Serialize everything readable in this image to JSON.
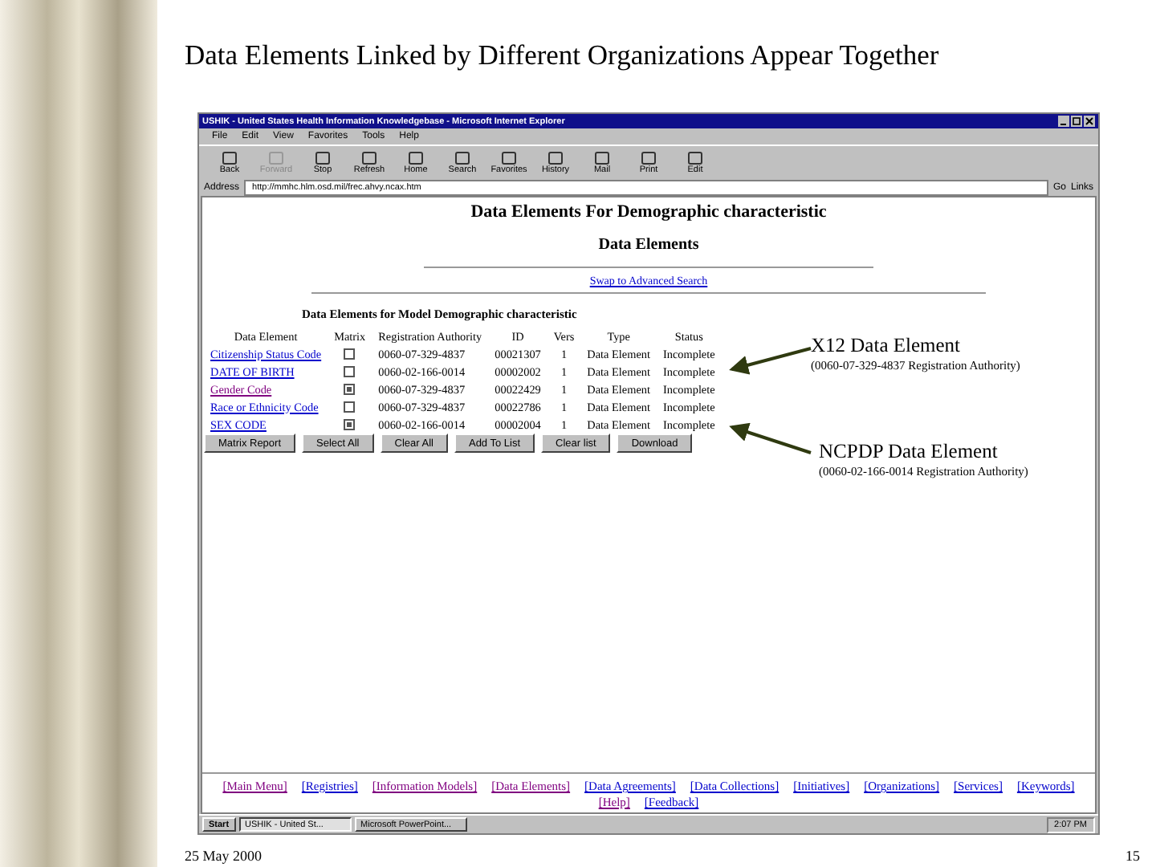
{
  "slide": {
    "title": "Data Elements Linked by Different Organizations Appear Together",
    "date": "25 May 2000",
    "page_number": "15"
  },
  "browser": {
    "title": "USHIK - United States Health Information Knowledgebase - Microsoft Internet Explorer",
    "menu": [
      "File",
      "Edit",
      "View",
      "Favorites",
      "Tools",
      "Help"
    ],
    "toolbar": [
      {
        "label": "Back",
        "disabled": false
      },
      {
        "label": "Forward",
        "disabled": true
      },
      {
        "label": "Stop",
        "disabled": false
      },
      {
        "label": "Refresh",
        "disabled": false
      },
      {
        "label": "Home",
        "disabled": false
      },
      {
        "label": "Search",
        "disabled": false
      },
      {
        "label": "Favorites",
        "disabled": false
      },
      {
        "label": "History",
        "disabled": false
      },
      {
        "label": "Mail",
        "disabled": false
      },
      {
        "label": "Print",
        "disabled": false
      },
      {
        "label": "Edit",
        "disabled": false
      }
    ],
    "address_label": "Address",
    "address": "http://mmhc.hlm.osd.mil/frec.ahvy.ncax.htm",
    "go": "Go",
    "links": "Links"
  },
  "page": {
    "heading": "Data Elements For Demographic characteristic",
    "subheading": "Data Elements",
    "swap_link": "Swap to Advanced Search",
    "table_title": "Data Elements for Model Demographic characteristic",
    "columns": [
      "Data Element",
      "Matrix",
      "Registration Authority",
      "ID",
      "Vers",
      "Type",
      "Status"
    ],
    "rows": [
      {
        "name": "Citizenship Status Code",
        "visited": false,
        "checked": false,
        "authority": "0060-07-329-4837",
        "id": "00021307",
        "vers": "1",
        "type": "Data Element",
        "status": "Incomplete"
      },
      {
        "name": "DATE OF BIRTH",
        "visited": false,
        "checked": false,
        "authority": "0060-02-166-0014",
        "id": "00002002",
        "vers": "1",
        "type": "Data Element",
        "status": "Incomplete"
      },
      {
        "name": "Gender Code",
        "visited": true,
        "checked": true,
        "authority": "0060-07-329-4837",
        "id": "00022429",
        "vers": "1",
        "type": "Data Element",
        "status": "Incomplete"
      },
      {
        "name": "Race or Ethnicity Code",
        "visited": false,
        "checked": false,
        "authority": "0060-07-329-4837",
        "id": "00022786",
        "vers": "1",
        "type": "Data Element",
        "status": "Incomplete"
      },
      {
        "name": "SEX CODE",
        "visited": false,
        "checked": true,
        "authority": "0060-02-166-0014",
        "id": "00002004",
        "vers": "1",
        "type": "Data Element",
        "status": "Incomplete"
      }
    ],
    "buttons": [
      "Matrix Report",
      "Select All",
      "Clear All",
      "Add To List",
      "Clear list",
      "Download"
    ],
    "footer_links": [
      {
        "label": "[Main Menu]",
        "visited": true
      },
      {
        "label": "[Registries]",
        "visited": false
      },
      {
        "label": "[Information Models]",
        "visited": true
      },
      {
        "label": "[Data Elements]",
        "visited": true
      },
      {
        "label": "[Data Agreements]",
        "visited": false
      },
      {
        "label": "[Data Collections]",
        "visited": false
      },
      {
        "label": "[Initiatives]",
        "visited": false
      },
      {
        "label": "[Organizations]",
        "visited": false
      },
      {
        "label": "[Services]",
        "visited": false
      },
      {
        "label": "[Keywords]",
        "visited": false
      },
      {
        "label": "[Help]",
        "visited": true
      },
      {
        "label": "[Feedback]",
        "visited": false
      }
    ]
  },
  "taskbar": {
    "start": "Start",
    "tasks": [
      {
        "label": "USHIK - United St...",
        "selected": true
      },
      {
        "label": "Microsoft PowerPoint...",
        "selected": false
      }
    ],
    "clock": "2:07 PM"
  },
  "callouts": [
    {
      "title": "X12 Data Element",
      "note": "(0060-07-329-4837 Registration Authority)"
    },
    {
      "title": "NCPDP Data Element",
      "note": "(0060-02-166-0014 Registration Authority)"
    }
  ]
}
